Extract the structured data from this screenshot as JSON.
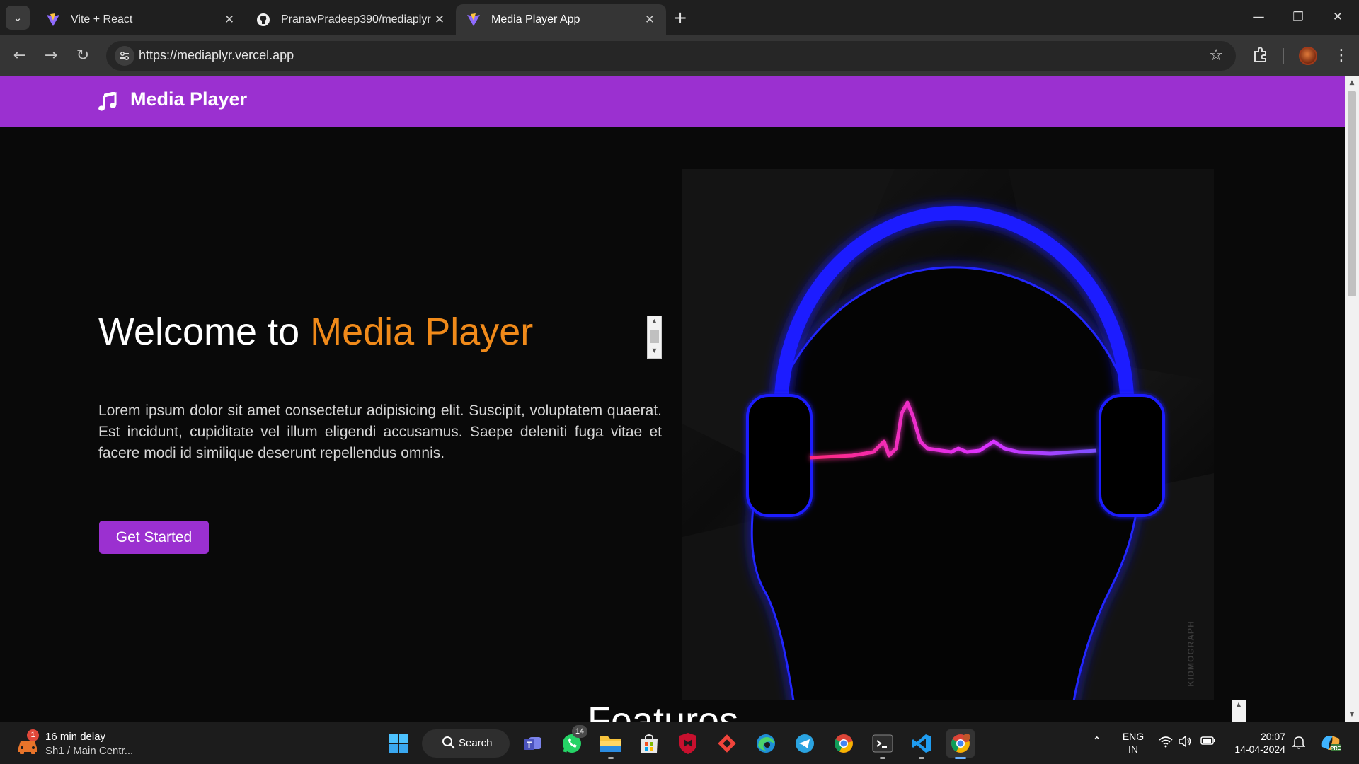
{
  "browser": {
    "tabs": [
      {
        "title": "Vite + React",
        "favicon": "vite-icon",
        "active": false
      },
      {
        "title": "PranavPradeep390/mediaplyr",
        "favicon": "github-icon",
        "active": false
      },
      {
        "title": "Media Player App",
        "favicon": "vite-icon",
        "active": true
      }
    ],
    "tab_close_glyph": "✕",
    "new_tab_glyph": "+",
    "url": "https://mediaplyr.vercel.app",
    "window_controls": {
      "minimize": "—",
      "restore": "❐",
      "close": "✕"
    }
  },
  "page": {
    "brand": "Media Player",
    "hero": {
      "title_prefix": "Welcome to ",
      "title_accent": "Media Player",
      "description": "Lorem ipsum dolor sit amet consectetur adipisicing elit. Suscipit, voluptatem quaerat. Est incidunt, cupiditate vel illum eligendi accusamus. Saepe deleniti fuga vitae et facere modi id similique deserunt repellendus omnis.",
      "cta_label": "Get Started",
      "image_watermark": "KIDMOGRAPH"
    },
    "features_heading": "Features",
    "colors": {
      "nav_bg": "#9b30d0",
      "accent": "#f08a1a",
      "page_bg": "#090909"
    }
  },
  "taskbar": {
    "weather": {
      "alert_count": "1",
      "line1": "16 min delay",
      "line2": "Sh1 / Main Centr..."
    },
    "search_label": "Search",
    "whatsapp_badge": "14",
    "pinned": [
      "windows-start",
      "search",
      "teams",
      "whatsapp",
      "file-explorer",
      "microsoft-store",
      "mcafee",
      "anydesk",
      "edge",
      "telegram",
      "chrome",
      "terminal",
      "vscode",
      "chrome-canary"
    ],
    "tray": {
      "lang_top": "ENG",
      "lang_bottom": "IN",
      "time": "20:07",
      "date": "14-04-2024"
    }
  }
}
